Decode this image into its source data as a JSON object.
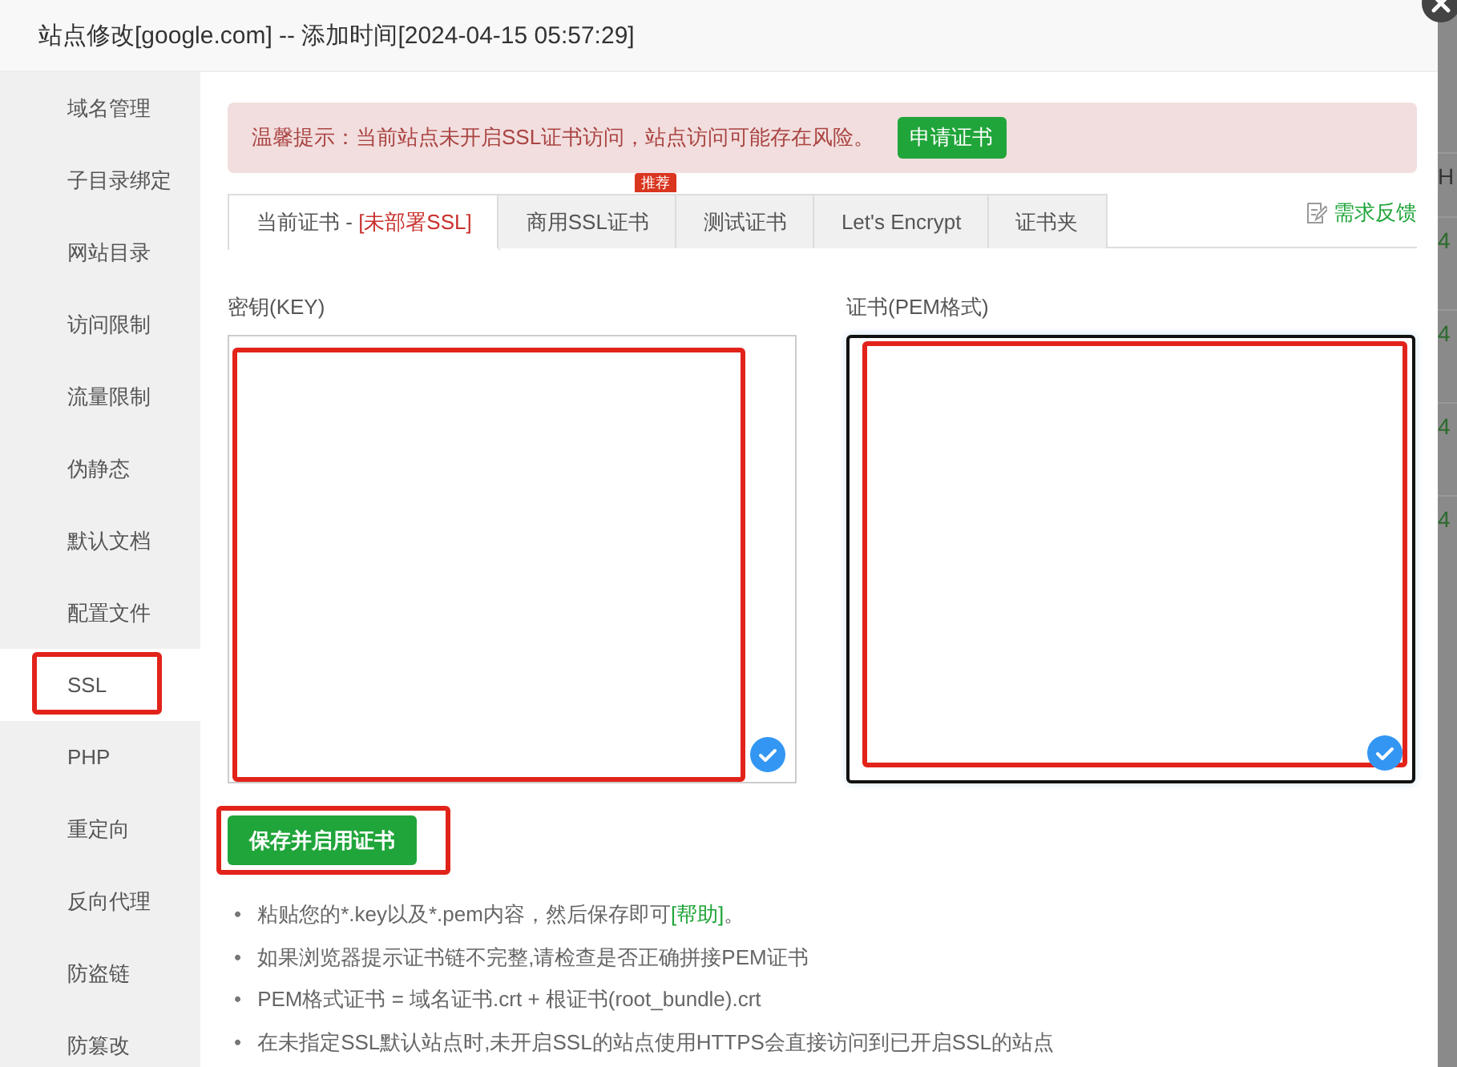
{
  "window": {
    "title": "站点修改[google.com] -- 添加时间[2024-04-15 05:57:29]"
  },
  "sidebar": {
    "items": [
      {
        "label": "域名管理",
        "selected": false,
        "annotated": false
      },
      {
        "label": "子目录绑定",
        "selected": false,
        "annotated": false
      },
      {
        "label": "网站目录",
        "selected": false,
        "annotated": false
      },
      {
        "label": "访问限制",
        "selected": false,
        "annotated": false
      },
      {
        "label": "流量限制",
        "selected": false,
        "annotated": false
      },
      {
        "label": "伪静态",
        "selected": false,
        "annotated": false
      },
      {
        "label": "默认文档",
        "selected": false,
        "annotated": false
      },
      {
        "label": "配置文件",
        "selected": false,
        "annotated": false
      },
      {
        "label": "SSL",
        "selected": true,
        "annotated": true
      },
      {
        "label": "PHP",
        "selected": false,
        "annotated": false
      },
      {
        "label": "重定向",
        "selected": false,
        "annotated": false
      },
      {
        "label": "反向代理",
        "selected": false,
        "annotated": false
      },
      {
        "label": "防盗链",
        "selected": false,
        "annotated": false
      },
      {
        "label": "防篡改",
        "selected": false,
        "annotated": false
      }
    ]
  },
  "alert": {
    "text": "温馨提示：当前站点未开启SSL证书访问，站点访问可能存在风险。",
    "button": "申请证书"
  },
  "tabs": [
    {
      "label": "当前证书 - ",
      "status": "[未部署SSL]",
      "selected": true
    },
    {
      "label": "商用SSL证书",
      "badge": "推荐",
      "selected": false
    },
    {
      "label": "测试证书",
      "selected": false
    },
    {
      "label": "Let's Encrypt",
      "selected": false
    },
    {
      "label": "证书夹",
      "selected": false
    }
  ],
  "feedback_link": "需求反馈",
  "fields": [
    {
      "label": "密钥(KEY)",
      "focused": false,
      "annotated": true
    },
    {
      "label": "证书(PEM格式)",
      "focused": true,
      "annotated": true
    }
  ],
  "save_button": {
    "label": "保存并启用证书",
    "annotated": true
  },
  "notes": [
    {
      "marker": "•",
      "text": "粘贴您的*.key以及*.pem内容，然后保存即可",
      "link": "[帮助]",
      "suffix": "。"
    },
    {
      "marker": "•",
      "text": "如果浏览器提示证书链不完整,请检查是否正确拼接PEM证书"
    },
    {
      "marker": "•",
      "text": "PEM格式证书 = 域名证书.crt + 根证书(root_bundle).crt"
    },
    {
      "marker": "•",
      "text": "在未指定SSL默认站点时,未开启SSL的站点使用HTTPS会直接访问到已开启SSL的站点"
    }
  ],
  "background_page": {
    "cells": [
      "H",
      "4",
      "4",
      "4",
      "4"
    ]
  }
}
